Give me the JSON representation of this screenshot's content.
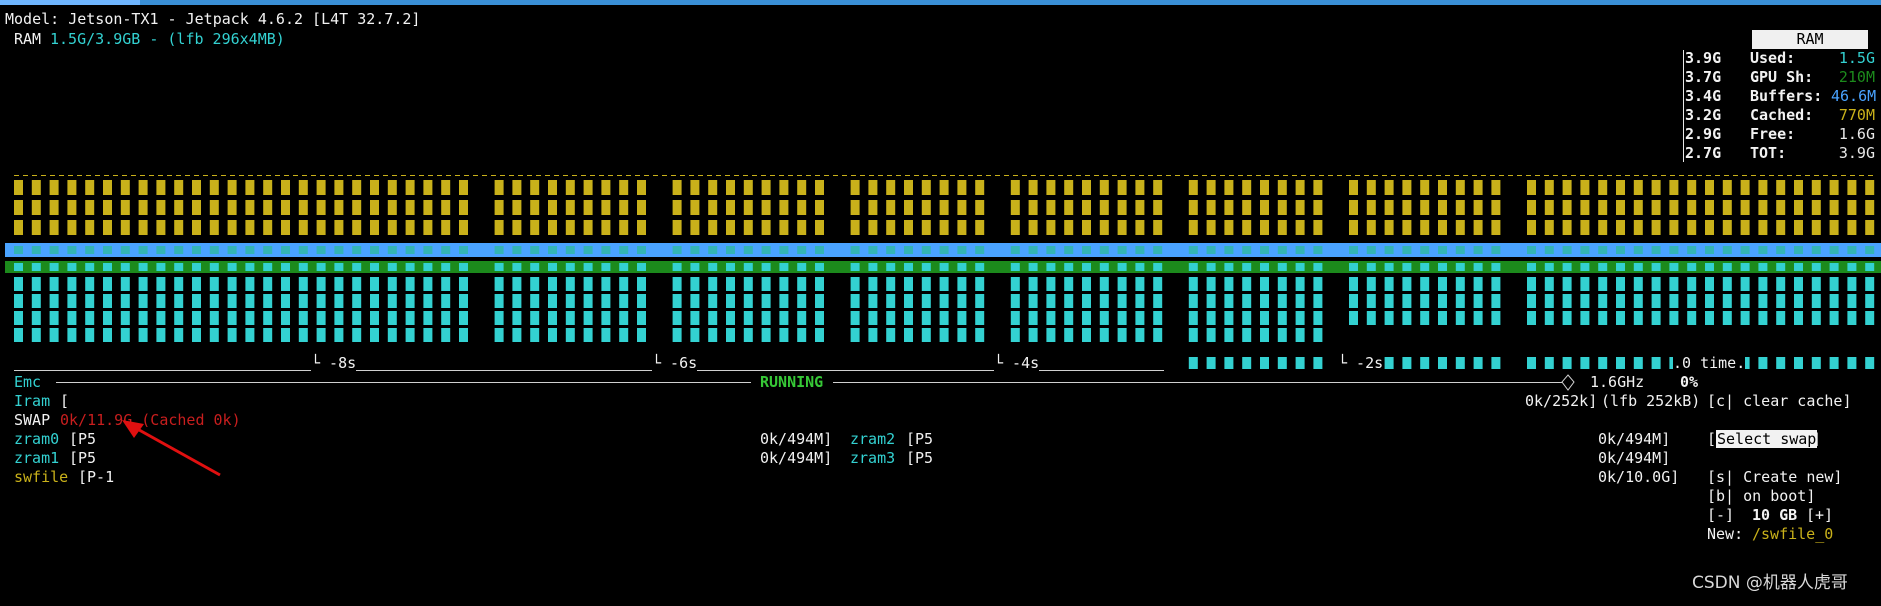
{
  "header": {
    "model": "Model: Jetson-TX1 - Jetpack 4.6.2 [L4T 32.7.2]",
    "ram_label": "RAM",
    "ram_value": "1.5G/3.9GB - (lfb 296x4MB)"
  },
  "ram_legend": {
    "title": "RAM",
    "ticks": [
      "3.9G",
      "3.7G",
      "3.4G",
      "3.2G",
      "2.9G",
      "2.7G"
    ],
    "items": [
      {
        "label": "Used:",
        "value": "1.5G",
        "color": "#33d1d1"
      },
      {
        "label": "GPU Sh:",
        "value": "210M",
        "color": "#1c8a1c"
      },
      {
        "label": "Buffers:",
        "value": "46.6M",
        "color": "#4aa3ff"
      },
      {
        "label": "Cached:",
        "value": "770M",
        "color": "#c9b11a"
      },
      {
        "label": "Free:",
        "value": "1.6G",
        "color": "#e8e8e8"
      },
      {
        "label": "TOT:",
        "value": "3.9G",
        "color": "#e8e8e8"
      }
    ]
  },
  "chart_axis": {
    "labels": [
      "└ -8s",
      "└ -6s",
      "└ -4s",
      "└ -2s"
    ],
    "time_label": ".0 time."
  },
  "emc": {
    "label": "Emc",
    "status": "RUNNING",
    "freq": "1.6GHz",
    "percent": "0%"
  },
  "iram": {
    "label": "Iram",
    "bracket": "[",
    "value": "0k/252k]",
    "lfb": "(lfb 252kB)",
    "clear_cache": "[c| clear cache]"
  },
  "swap": {
    "label": "SWAP",
    "value": "0k/11.9G (Cached 0k)",
    "devices": [
      {
        "name": "zram0",
        "prio": "[P5",
        "usage": "0k/494M]",
        "color": "#33d1d1"
      },
      {
        "name": "zram1",
        "prio": "[P5",
        "usage": "0k/494M]",
        "color": "#33d1d1"
      },
      {
        "name": "swfile",
        "prio": "[P-1",
        "usage": "",
        "color": "#c9b11a"
      },
      {
        "name": "zram2",
        "prio": "[P5",
        "usage": "0k/494M]",
        "color": "#33d1d1"
      },
      {
        "name": "zram3",
        "prio": "[P5",
        "usage": "0k/494M]",
        "color": "#33d1d1"
      },
      {
        "name": "",
        "prio": "",
        "usage": "0k/10.0G]",
        "color": "#e8e8e8"
      }
    ]
  },
  "swap_menu": {
    "select": "Select swap",
    "create": "[s| Create new]",
    "boot": "[b| on boot]",
    "size_minus": "[-]",
    "size": "10 GB",
    "size_plus": "[+]",
    "new_label": "New:",
    "new_path": "/swfile_0"
  },
  "watermark": "CSDN @机器人虎哥"
}
